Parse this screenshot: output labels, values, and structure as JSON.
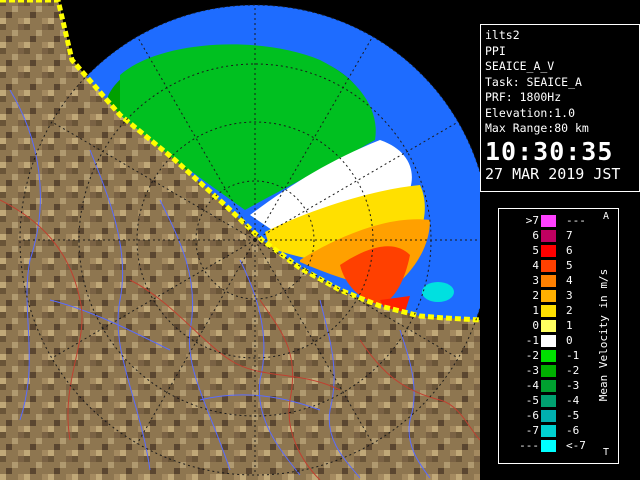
{
  "info": {
    "station": "ilts2",
    "product": "PPI",
    "scan": "SEAICE_A_V",
    "task": "Task: SEAICE_A",
    "prf": "PRF: 1800Hz",
    "elevation": "Elevation:1.0",
    "range": "Max Range:80 km",
    "time": "10:30:35",
    "date": "27 MAR 2019 JST"
  },
  "legend": {
    "title": "Mean Velocity in m/s",
    "top_tag": "A",
    "bottom_tag": "T",
    "rows": [
      {
        "left": ">7",
        "right": "---",
        "color": "#ff40ff"
      },
      {
        "left": "6",
        "right": "7",
        "color": "#c00060"
      },
      {
        "left": "5",
        "right": "6",
        "color": "#ff0000"
      },
      {
        "left": "4",
        "right": "5",
        "color": "#ff4000"
      },
      {
        "left": "3",
        "right": "4",
        "color": "#ff8000"
      },
      {
        "left": "2",
        "right": "3",
        "color": "#ffb000"
      },
      {
        "left": "1",
        "right": "2",
        "color": "#ffe000"
      },
      {
        "left": "0",
        "right": "1",
        "color": "#ffff60"
      },
      {
        "left": "-1",
        "right": "0",
        "color": "#ffffff"
      },
      {
        "left": "-2",
        "right": "-1",
        "color": "#00e000"
      },
      {
        "left": "-3",
        "right": "-2",
        "color": "#00b000"
      },
      {
        "left": "-4",
        "right": "-3",
        "color": "#00a030"
      },
      {
        "left": "-5",
        "right": "-4",
        "color": "#00a070"
      },
      {
        "left": "-6",
        "right": "-5",
        "color": "#00b0b0"
      },
      {
        "left": "-7",
        "right": "-6",
        "color": "#00d0d0"
      },
      {
        "left": "---",
        "right": "<-7",
        "color": "#00ffff"
      }
    ]
  }
}
